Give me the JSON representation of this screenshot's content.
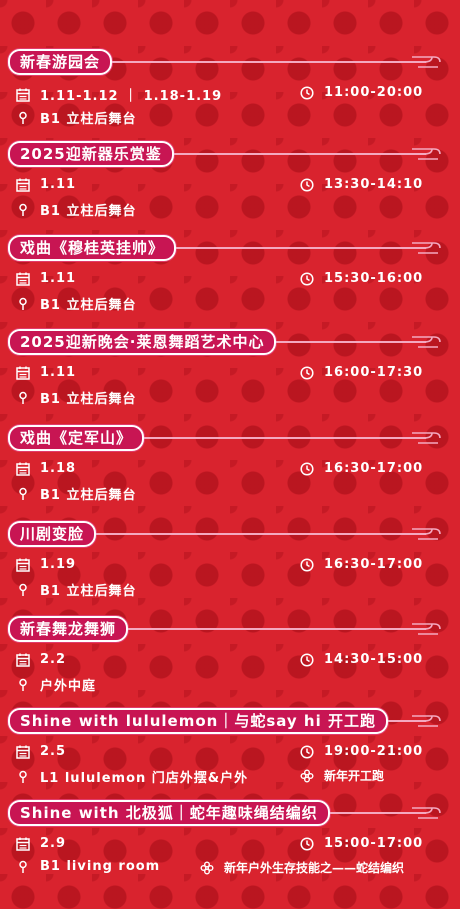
{
  "events": [
    {
      "title": "新春游园会",
      "date": "1.11-1.12  ｜  1.18-1.19",
      "time": "11:00-20:00",
      "location": "B1 立柱后舞台",
      "extra": ""
    },
    {
      "title": "2025迎新器乐赏鉴",
      "date": "1.11",
      "time": "13:30-14:10",
      "location": "B1 立柱后舞台",
      "extra": ""
    },
    {
      "title": "戏曲《穆桂英挂帅》",
      "date": "1.11",
      "time": "15:30-16:00",
      "location": "B1 立柱后舞台",
      "extra": ""
    },
    {
      "title": "2025迎新晚会·莱恩舞蹈艺术中心",
      "date": "1.11",
      "time": "16:00-17:30",
      "location": "B1 立柱后舞台",
      "extra": ""
    },
    {
      "title": "戏曲《定军山》",
      "date": "1.18",
      "time": "16:30-17:00",
      "location": "B1 立柱后舞台",
      "extra": ""
    },
    {
      "title": "川剧变脸",
      "date": "1.19",
      "time": "16:30-17:00",
      "location": "B1 立柱后舞台",
      "extra": ""
    },
    {
      "title": "新春舞龙舞狮",
      "date": "2.2",
      "time": "14:30-15:00",
      "location": "户外中庭",
      "extra": ""
    },
    {
      "title": "Shine with lululemon｜与蛇say hi 开工跑",
      "date": "2.5",
      "time": "19:00-21:00",
      "location": "L1 lululemon 门店外摆&户外",
      "extra": "新年开工跑"
    },
    {
      "title": "Shine with 北极狐｜蛇年趣味绳结编织",
      "date": "2.9",
      "time": "15:00-17:00",
      "location": "B1 living room",
      "extra": "新年户外生存技能之——蛇结编织"
    }
  ],
  "icons": {
    "date": "calendar-icon",
    "time": "clock-icon",
    "location": "location-pin-icon",
    "extra": "knot-icon"
  },
  "colors": {
    "background": "#d9232e",
    "pill": "#c81553"
  }
}
